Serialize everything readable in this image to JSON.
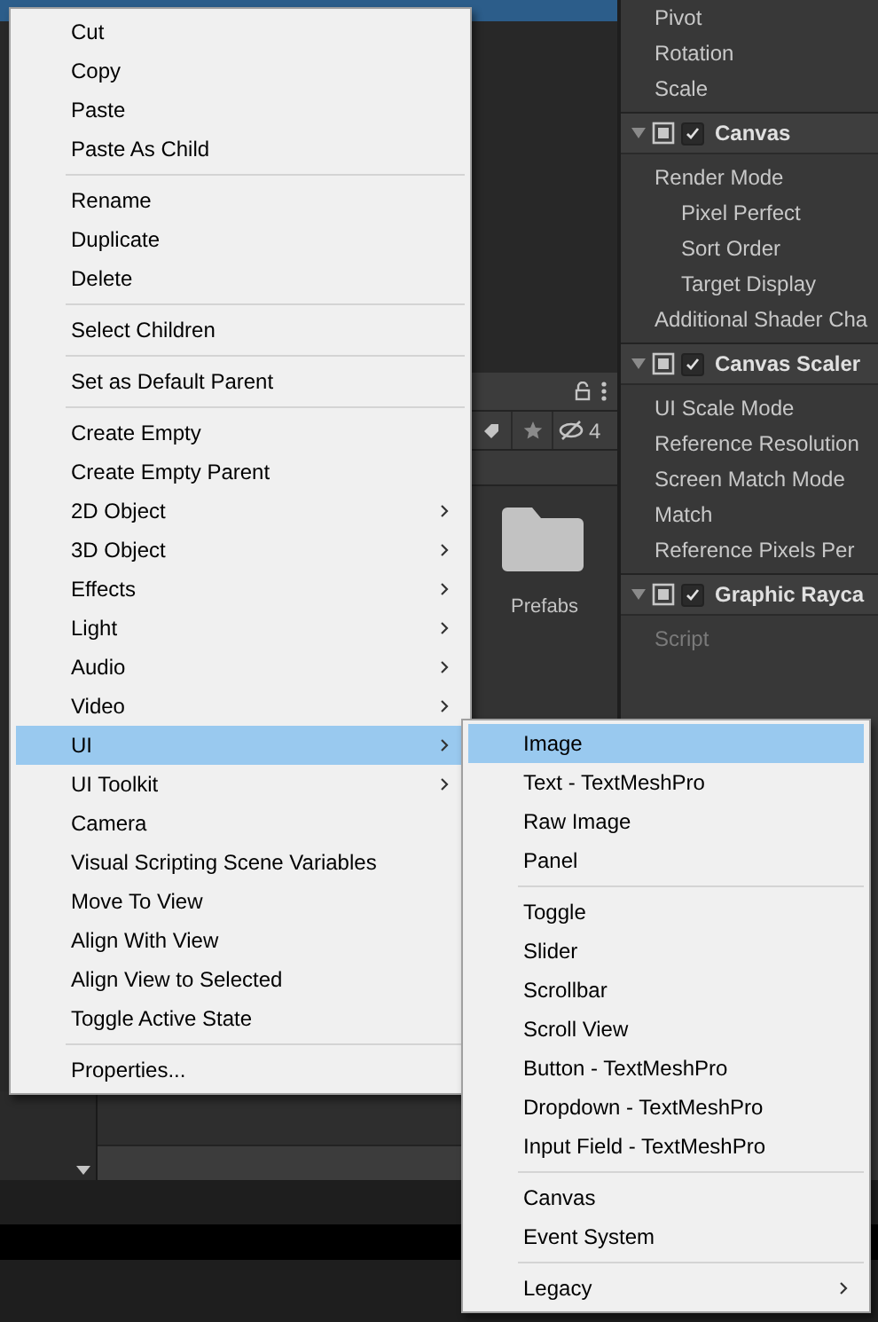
{
  "inspector": {
    "rows": [
      {
        "kind": "field",
        "label": "Pivot",
        "indented": false,
        "disabled": false
      },
      {
        "kind": "field",
        "label": "Rotation",
        "indented": false,
        "disabled": false
      },
      {
        "kind": "field",
        "label": "Scale",
        "indented": false,
        "disabled": false
      },
      {
        "kind": "component",
        "label": "Canvas",
        "checked": true,
        "expanded": true
      },
      {
        "kind": "field",
        "label": "Render Mode",
        "indented": false,
        "disabled": false
      },
      {
        "kind": "field",
        "label": "Pixel Perfect",
        "indented": true,
        "disabled": false
      },
      {
        "kind": "field",
        "label": "Sort Order",
        "indented": true,
        "disabled": false
      },
      {
        "kind": "field",
        "label": "Target Display",
        "indented": true,
        "disabled": false
      },
      {
        "kind": "field",
        "label": "Additional Shader Cha",
        "indented": false,
        "disabled": false
      },
      {
        "kind": "component",
        "label": "Canvas Scaler",
        "checked": true,
        "expanded": true
      },
      {
        "kind": "field",
        "label": "UI Scale Mode",
        "indented": false,
        "disabled": false
      },
      {
        "kind": "field",
        "label": "Reference Resolution",
        "indented": false,
        "disabled": false
      },
      {
        "kind": "field",
        "label": "Screen Match Mode",
        "indented": false,
        "disabled": false
      },
      {
        "kind": "field",
        "label": "Match",
        "indented": false,
        "disabled": false
      },
      {
        "kind": "field",
        "label": "Reference Pixels Per",
        "indented": false,
        "disabled": false
      },
      {
        "kind": "component",
        "label": "Graphic Rayca",
        "checked": true,
        "expanded": true
      },
      {
        "kind": "field",
        "label": "Script",
        "indented": false,
        "disabled": true
      }
    ]
  },
  "project_panel": {
    "hidden_count": "4",
    "assets": [
      {
        "label": "Prefabs"
      }
    ]
  },
  "context_menu": {
    "items": [
      {
        "kind": "item",
        "label": "Cut",
        "submenu": false,
        "selected": false
      },
      {
        "kind": "item",
        "label": "Copy",
        "submenu": false,
        "selected": false
      },
      {
        "kind": "item",
        "label": "Paste",
        "submenu": false,
        "selected": false
      },
      {
        "kind": "item",
        "label": "Paste As Child",
        "submenu": false,
        "selected": false
      },
      {
        "kind": "separator"
      },
      {
        "kind": "item",
        "label": "Rename",
        "submenu": false,
        "selected": false
      },
      {
        "kind": "item",
        "label": "Duplicate",
        "submenu": false,
        "selected": false
      },
      {
        "kind": "item",
        "label": "Delete",
        "submenu": false,
        "selected": false
      },
      {
        "kind": "separator"
      },
      {
        "kind": "item",
        "label": "Select Children",
        "submenu": false,
        "selected": false
      },
      {
        "kind": "separator"
      },
      {
        "kind": "item",
        "label": "Set as Default Parent",
        "submenu": false,
        "selected": false
      },
      {
        "kind": "separator"
      },
      {
        "kind": "item",
        "label": "Create Empty",
        "submenu": false,
        "selected": false
      },
      {
        "kind": "item",
        "label": "Create Empty Parent",
        "submenu": false,
        "selected": false
      },
      {
        "kind": "item",
        "label": "2D Object",
        "submenu": true,
        "selected": false
      },
      {
        "kind": "item",
        "label": "3D Object",
        "submenu": true,
        "selected": false
      },
      {
        "kind": "item",
        "label": "Effects",
        "submenu": true,
        "selected": false
      },
      {
        "kind": "item",
        "label": "Light",
        "submenu": true,
        "selected": false
      },
      {
        "kind": "item",
        "label": "Audio",
        "submenu": true,
        "selected": false
      },
      {
        "kind": "item",
        "label": "Video",
        "submenu": true,
        "selected": false
      },
      {
        "kind": "item",
        "label": "UI",
        "submenu": true,
        "selected": true
      },
      {
        "kind": "item",
        "label": "UI Toolkit",
        "submenu": true,
        "selected": false
      },
      {
        "kind": "item",
        "label": "Camera",
        "submenu": false,
        "selected": false
      },
      {
        "kind": "item",
        "label": "Visual Scripting Scene Variables",
        "submenu": false,
        "selected": false
      },
      {
        "kind": "item",
        "label": "Move To View",
        "submenu": false,
        "selected": false
      },
      {
        "kind": "item",
        "label": "Align With View",
        "submenu": false,
        "selected": false
      },
      {
        "kind": "item",
        "label": "Align View to Selected",
        "submenu": false,
        "selected": false
      },
      {
        "kind": "item",
        "label": "Toggle Active State",
        "submenu": false,
        "selected": false
      },
      {
        "kind": "separator"
      },
      {
        "kind": "item",
        "label": "Properties...",
        "submenu": false,
        "selected": false
      }
    ]
  },
  "ui_submenu": {
    "items": [
      {
        "kind": "item",
        "label": "Image",
        "submenu": false,
        "selected": true
      },
      {
        "kind": "item",
        "label": "Text - TextMeshPro",
        "submenu": false,
        "selected": false
      },
      {
        "kind": "item",
        "label": "Raw Image",
        "submenu": false,
        "selected": false
      },
      {
        "kind": "item",
        "label": "Panel",
        "submenu": false,
        "selected": false
      },
      {
        "kind": "separator"
      },
      {
        "kind": "item",
        "label": "Toggle",
        "submenu": false,
        "selected": false
      },
      {
        "kind": "item",
        "label": "Slider",
        "submenu": false,
        "selected": false
      },
      {
        "kind": "item",
        "label": "Scrollbar",
        "submenu": false,
        "selected": false
      },
      {
        "kind": "item",
        "label": "Scroll View",
        "submenu": false,
        "selected": false
      },
      {
        "kind": "item",
        "label": "Button - TextMeshPro",
        "submenu": false,
        "selected": false
      },
      {
        "kind": "item",
        "label": "Dropdown - TextMeshPro",
        "submenu": false,
        "selected": false
      },
      {
        "kind": "item",
        "label": "Input Field - TextMeshPro",
        "submenu": false,
        "selected": false
      },
      {
        "kind": "separator"
      },
      {
        "kind": "item",
        "label": "Canvas",
        "submenu": false,
        "selected": false
      },
      {
        "kind": "item",
        "label": "Event System",
        "submenu": false,
        "selected": false
      },
      {
        "kind": "separator"
      },
      {
        "kind": "item",
        "label": "Legacy",
        "submenu": true,
        "selected": false
      }
    ]
  }
}
